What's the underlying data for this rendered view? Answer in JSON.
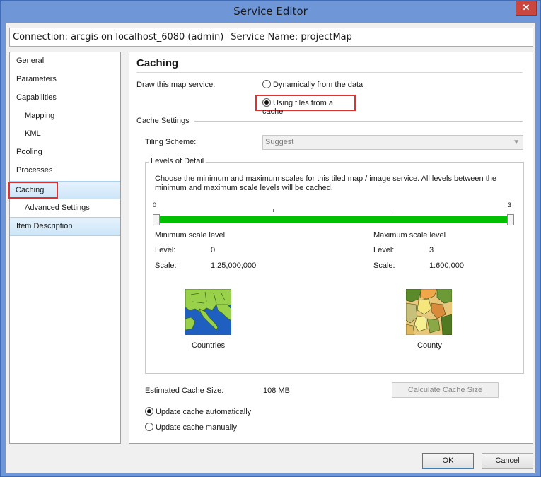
{
  "window": {
    "title": "Service Editor",
    "close_glyph": "✕"
  },
  "connection": {
    "label": "Connection: arcgis on localhost_6080 (admin)",
    "service": "Service Name: projectMap"
  },
  "nav": {
    "items": [
      {
        "label": "General"
      },
      {
        "label": "Parameters"
      },
      {
        "label": "Capabilities"
      },
      {
        "label": "Mapping"
      },
      {
        "label": "KML"
      },
      {
        "label": "Pooling"
      },
      {
        "label": "Processes"
      },
      {
        "label": "Caching"
      },
      {
        "label": "Advanced Settings"
      },
      {
        "label": "Item Description"
      }
    ]
  },
  "caching": {
    "title": "Caching",
    "draw_label": "Draw this map service:",
    "option_dynamic": "Dynamically from the data",
    "option_tiles": "Using tiles from a cache",
    "cache_settings_label": "Cache Settings",
    "tiling_scheme_label": "Tiling Scheme:",
    "tiling_scheme_value": "Suggest",
    "lod": {
      "legend": "Levels of Detail",
      "description": "Choose the minimum and maximum scales for this tiled map / image service. All levels between the minimum and maximum scale levels will be cached.",
      "min_tick": "0",
      "max_tick": "3",
      "min_title": "Minimum scale level",
      "max_title": "Maximum scale level",
      "level_label": "Level:",
      "scale_label": "Scale:",
      "min_level": "0",
      "max_level": "3",
      "min_scale": "1:25,000,000",
      "max_scale": "1:600,000",
      "min_caption": "Countries",
      "max_caption": "County"
    },
    "estimated_label": "Estimated Cache Size:",
    "estimated_value": "108 MB",
    "calc_button": "Calculate Cache Size",
    "update_auto": "Update cache automatically",
    "update_manual": "Update cache manually"
  },
  "footer": {
    "ok": "OK",
    "cancel": "Cancel"
  },
  "colors": {
    "accent_outline": "#e03030",
    "slider_fill": "#00c000"
  }
}
